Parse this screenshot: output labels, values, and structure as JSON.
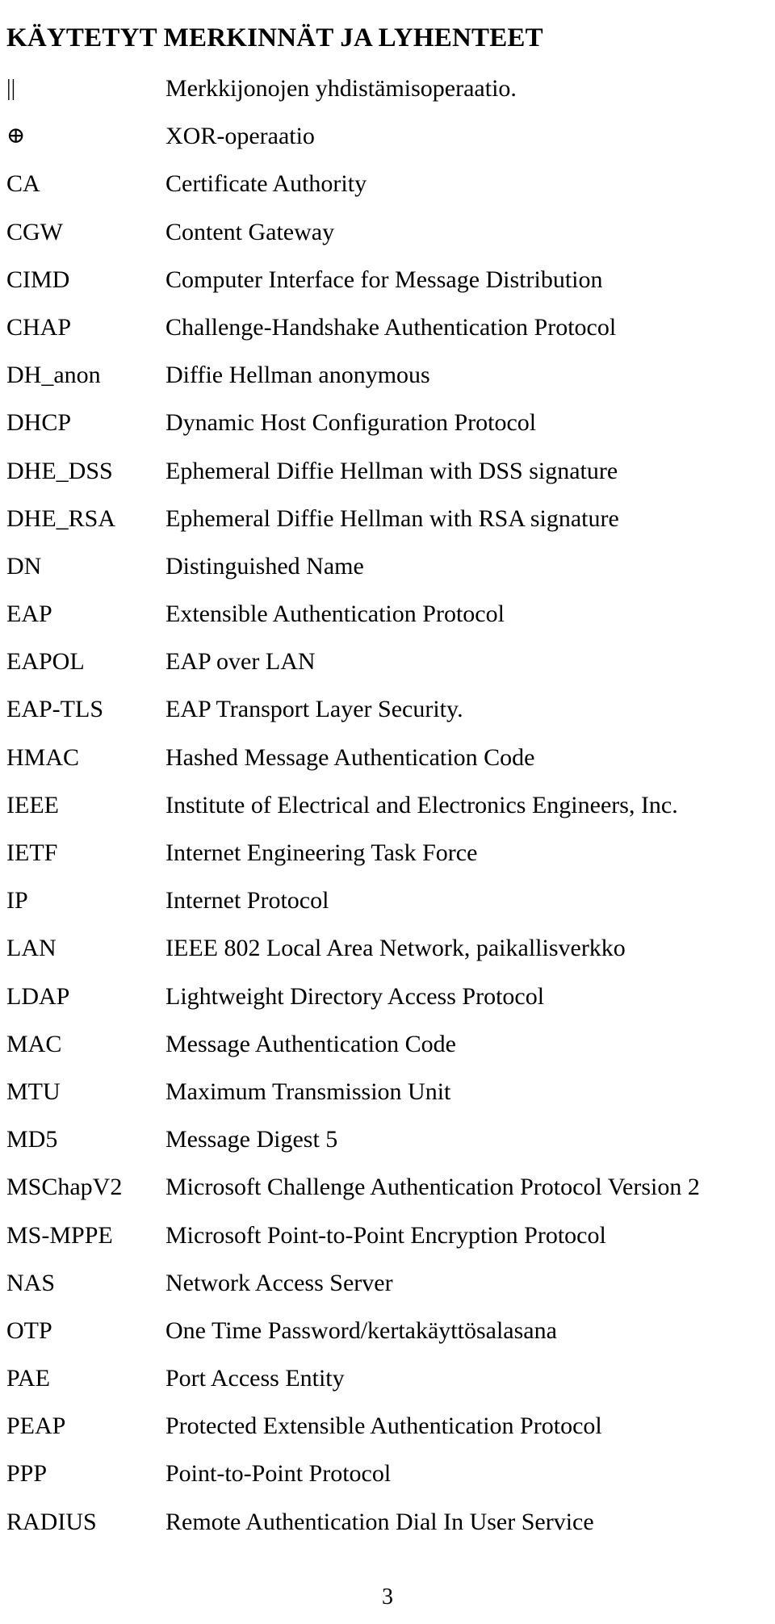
{
  "document": {
    "title": "KÄYTETYT MERKINNÄT JA LYHENTEET",
    "page_number": "3"
  },
  "abbreviations": [
    {
      "term": "||",
      "definition": "Merkkijonojen yhdistämisoperaatio."
    },
    {
      "term": "⊕",
      "definition": "XOR-operaatio"
    },
    {
      "term": "CA",
      "definition": "Certificate Authority"
    },
    {
      "term": "CGW",
      "definition": "Content Gateway"
    },
    {
      "term": "CIMD",
      "definition": "Computer Interface for Message Distribution"
    },
    {
      "term": "CHAP",
      "definition": "Challenge-Handshake Authentication Protocol"
    },
    {
      "term": "DH_anon",
      "definition": "Diffie Hellman anonymous"
    },
    {
      "term": "DHCP",
      "definition": "Dynamic Host Configuration Protocol"
    },
    {
      "term": "DHE_DSS",
      "definition": "Ephemeral Diffie Hellman with DSS signature"
    },
    {
      "term": "DHE_RSA",
      "definition": "Ephemeral Diffie Hellman with RSA signature"
    },
    {
      "term": "DN",
      "definition": "Distinguished Name"
    },
    {
      "term": "EAP",
      "definition": "Extensible Authentication Protocol"
    },
    {
      "term": "EAPOL",
      "definition": "EAP over LAN"
    },
    {
      "term": "EAP-TLS",
      "definition": "EAP Transport Layer Security."
    },
    {
      "term": "HMAC",
      "definition": "Hashed Message Authentication Code"
    },
    {
      "term": "IEEE",
      "definition": "Institute of Electrical and Electronics Engineers, Inc."
    },
    {
      "term": "IETF",
      "definition": "Internet Engineering Task Force"
    },
    {
      "term": "IP",
      "definition": "Internet Protocol"
    },
    {
      "term": "LAN",
      "definition": "IEEE 802 Local Area Network, paikallisverkko"
    },
    {
      "term": "LDAP",
      "definition": "Lightweight Directory Access Protocol"
    },
    {
      "term": "MAC",
      "definition": "Message Authentication Code"
    },
    {
      "term": "MTU",
      "definition": "Maximum Transmission Unit"
    },
    {
      "term": "MD5",
      "definition": "Message Digest 5"
    },
    {
      "term": "MSChapV2",
      "definition": "Microsoft Challenge Authentication Protocol Version 2"
    },
    {
      "term": "MS-MPPE",
      "definition": "Microsoft Point-to-Point Encryption Protocol"
    },
    {
      "term": "NAS",
      "definition": "Network Access Server"
    },
    {
      "term": "OTP",
      "definition": "One Time Password/kertakäyttösalasana"
    },
    {
      "term": "PAE",
      "definition": "Port Access Entity"
    },
    {
      "term": "PEAP",
      "definition": "Protected Extensible Authentication Protocol"
    },
    {
      "term": "PPP",
      "definition": "Point-to-Point Protocol"
    },
    {
      "term": "RADIUS",
      "definition": "Remote Authentication Dial In User Service"
    }
  ]
}
